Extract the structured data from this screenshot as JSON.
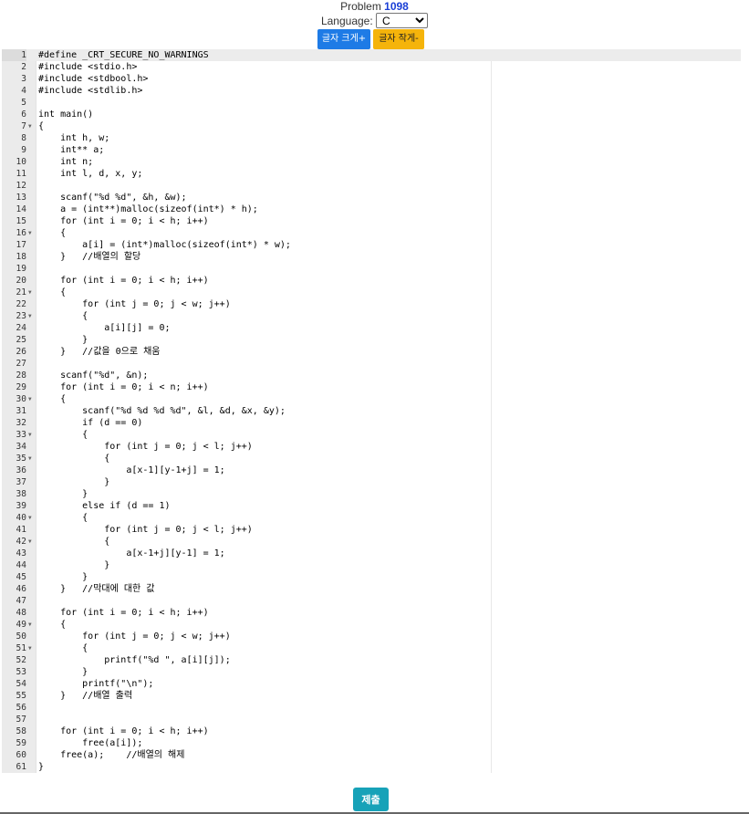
{
  "header": {
    "problem_label": "Problem",
    "problem_number": "1098",
    "language_label": "Language:",
    "language_selected": "C",
    "font_increase_label": "글자 크게+",
    "font_decrease_label": "글자 작게-"
  },
  "editor": {
    "active_line": 1,
    "lines": [
      {
        "n": "1",
        "fold": false,
        "text": "#define _CRT_SECURE_NO_WARNINGS"
      },
      {
        "n": "2",
        "fold": false,
        "text": "#include <stdio.h>"
      },
      {
        "n": "3",
        "fold": false,
        "text": "#include <stdbool.h>"
      },
      {
        "n": "4",
        "fold": false,
        "text": "#include <stdlib.h>"
      },
      {
        "n": "5",
        "fold": false,
        "text": ""
      },
      {
        "n": "6",
        "fold": false,
        "text": "int main()"
      },
      {
        "n": "7",
        "fold": true,
        "text": "{"
      },
      {
        "n": "8",
        "fold": false,
        "text": "    int h, w;"
      },
      {
        "n": "9",
        "fold": false,
        "text": "    int** a;"
      },
      {
        "n": "10",
        "fold": false,
        "text": "    int n;"
      },
      {
        "n": "11",
        "fold": false,
        "text": "    int l, d, x, y;"
      },
      {
        "n": "12",
        "fold": false,
        "text": ""
      },
      {
        "n": "13",
        "fold": false,
        "text": "    scanf(\"%d %d\", &h, &w);"
      },
      {
        "n": "14",
        "fold": false,
        "text": "    a = (int**)malloc(sizeof(int*) * h);"
      },
      {
        "n": "15",
        "fold": false,
        "text": "    for (int i = 0; i < h; i++)"
      },
      {
        "n": "16",
        "fold": true,
        "text": "    {"
      },
      {
        "n": "17",
        "fold": false,
        "text": "        a[i] = (int*)malloc(sizeof(int*) * w);"
      },
      {
        "n": "18",
        "fold": false,
        "text": "    }   //배열의 할당"
      },
      {
        "n": "19",
        "fold": false,
        "text": ""
      },
      {
        "n": "20",
        "fold": false,
        "text": "    for (int i = 0; i < h; i++)"
      },
      {
        "n": "21",
        "fold": true,
        "text": "    {"
      },
      {
        "n": "22",
        "fold": false,
        "text": "        for (int j = 0; j < w; j++)"
      },
      {
        "n": "23",
        "fold": true,
        "text": "        {"
      },
      {
        "n": "24",
        "fold": false,
        "text": "            a[i][j] = 0;"
      },
      {
        "n": "25",
        "fold": false,
        "text": "        }"
      },
      {
        "n": "26",
        "fold": false,
        "text": "    }   //값을 0으로 채움"
      },
      {
        "n": "27",
        "fold": false,
        "text": ""
      },
      {
        "n": "28",
        "fold": false,
        "text": "    scanf(\"%d\", &n);"
      },
      {
        "n": "29",
        "fold": false,
        "text": "    for (int i = 0; i < n; i++)"
      },
      {
        "n": "30",
        "fold": true,
        "text": "    {"
      },
      {
        "n": "31",
        "fold": false,
        "text": "        scanf(\"%d %d %d %d\", &l, &d, &x, &y);"
      },
      {
        "n": "32",
        "fold": false,
        "text": "        if (d == 0)"
      },
      {
        "n": "33",
        "fold": true,
        "text": "        {"
      },
      {
        "n": "34",
        "fold": false,
        "text": "            for (int j = 0; j < l; j++)"
      },
      {
        "n": "35",
        "fold": true,
        "text": "            {"
      },
      {
        "n": "36",
        "fold": false,
        "text": "                a[x-1][y-1+j] = 1;"
      },
      {
        "n": "37",
        "fold": false,
        "text": "            }"
      },
      {
        "n": "38",
        "fold": false,
        "text": "        }"
      },
      {
        "n": "39",
        "fold": false,
        "text": "        else if (d == 1)"
      },
      {
        "n": "40",
        "fold": true,
        "text": "        {"
      },
      {
        "n": "41",
        "fold": false,
        "text": "            for (int j = 0; j < l; j++)"
      },
      {
        "n": "42",
        "fold": true,
        "text": "            {"
      },
      {
        "n": "43",
        "fold": false,
        "text": "                a[x-1+j][y-1] = 1;"
      },
      {
        "n": "44",
        "fold": false,
        "text": "            }"
      },
      {
        "n": "45",
        "fold": false,
        "text": "        }"
      },
      {
        "n": "46",
        "fold": false,
        "text": "    }   //막대에 대한 값"
      },
      {
        "n": "47",
        "fold": false,
        "text": ""
      },
      {
        "n": "48",
        "fold": false,
        "text": "    for (int i = 0; i < h; i++)"
      },
      {
        "n": "49",
        "fold": true,
        "text": "    {"
      },
      {
        "n": "50",
        "fold": false,
        "text": "        for (int j = 0; j < w; j++)"
      },
      {
        "n": "51",
        "fold": true,
        "text": "        {"
      },
      {
        "n": "52",
        "fold": false,
        "text": "            printf(\"%d \", a[i][j]);"
      },
      {
        "n": "53",
        "fold": false,
        "text": "        }"
      },
      {
        "n": "54",
        "fold": false,
        "text": "        printf(\"\\n\");"
      },
      {
        "n": "55",
        "fold": false,
        "text": "    }   //배열 출력"
      },
      {
        "n": "56",
        "fold": false,
        "text": ""
      },
      {
        "n": "57",
        "fold": false,
        "text": ""
      },
      {
        "n": "58",
        "fold": false,
        "text": "    for (int i = 0; i < h; i++)"
      },
      {
        "n": "59",
        "fold": false,
        "text": "        free(a[i]);"
      },
      {
        "n": "60",
        "fold": false,
        "text": "    free(a);    //배열의 해제"
      },
      {
        "n": "61",
        "fold": false,
        "text": "}"
      }
    ]
  },
  "submit_label": "제출",
  "icons": {
    "fold": "fold-arrow-icon",
    "dropdown": "chevron-down-icon"
  },
  "colors": {
    "primary_button": "#1e7be6",
    "warning_button": "#f5b40b",
    "submit_button": "#17a2b8",
    "problem_number": "#1a3fd6"
  }
}
